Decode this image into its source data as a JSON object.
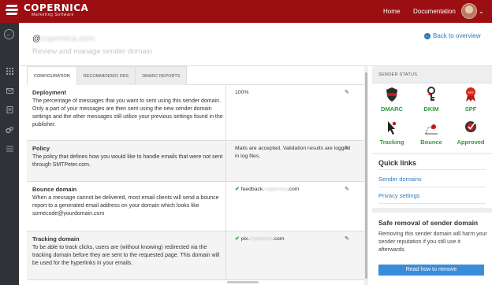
{
  "app": {
    "logo_name": "COPERNICA",
    "logo_sub": "Marketing Software",
    "nav": [
      {
        "label": "Home"
      },
      {
        "label": "Documentation"
      }
    ],
    "colors": {
      "brand": "#9b0f12",
      "link": "#2f7ab8",
      "success": "#2e9a3c",
      "button": "#3a8cd8"
    }
  },
  "sidebar": {
    "icons": [
      "back-circle-icon",
      "grid-icon",
      "envelope-icon",
      "document-icon",
      "gears-icon",
      "list-icon"
    ]
  },
  "header": {
    "title_prefix": "@",
    "title_domain": "copernica.com",
    "subtitle": "Review and manage sender domain",
    "back_link": "Back to overview"
  },
  "tabs": [
    {
      "label": "Configuration",
      "active": true
    },
    {
      "label": "Recommended DNS",
      "active": false
    },
    {
      "label": "DMARC Reports",
      "active": false
    }
  ],
  "settings": [
    {
      "label": "Deployment",
      "description": "The percentage of messages that you want to sent using this sender domain. Only a part of your messages are then sent using the new sender domain settings and the other messages still utilize your previous settings found in the publisher.",
      "value": "100%",
      "check": false
    },
    {
      "label": "Policy",
      "description": "The policy that defines how you would like to handle emails that were not sent through SMTPeter.com.",
      "value": "Mails are accepted. Validation results are logged in log files.",
      "check": false
    },
    {
      "label": "Bounce domain",
      "description": "When a message cannot be delivered, most email clients will send a bounce report to a generated email address on your domain which looks like somecode@yourdomain.com",
      "value_prefix": "feedback.",
      "value_blur": "copernica",
      "value_suffix": ".com",
      "check": true
    },
    {
      "label": "Tracking domain",
      "description": "To be able to track clicks, users are (without knowing) redirected via the tracking domain before they are sent to the requested page. This domain will be used for the hyperlinks in your emails.",
      "value_prefix": "pix.",
      "value_blur": "copernica",
      "value_suffix": ".com",
      "check": true
    }
  ],
  "sender_status": {
    "heading": "Sender status",
    "items": [
      {
        "label": "DMARC",
        "icon": "shield-icon"
      },
      {
        "label": "DKIM",
        "icon": "key-icon"
      },
      {
        "label": "SPF",
        "icon": "ribbon-badge-icon"
      },
      {
        "label": "Tracking",
        "icon": "cursor-icon"
      },
      {
        "label": "Bounce",
        "icon": "bounce-icon"
      },
      {
        "label": "Approved",
        "icon": "approved-badge-icon"
      }
    ]
  },
  "quick_links": {
    "title": "Quick links",
    "items": [
      {
        "label": "Sender domains"
      },
      {
        "label": "Privacy settings"
      }
    ]
  },
  "safe_removal": {
    "title": "Safe removal of sender domain",
    "text": "Removing this sender domain will harm your sender reputation if you still use it afterwards.",
    "button": "Read how to remove"
  }
}
